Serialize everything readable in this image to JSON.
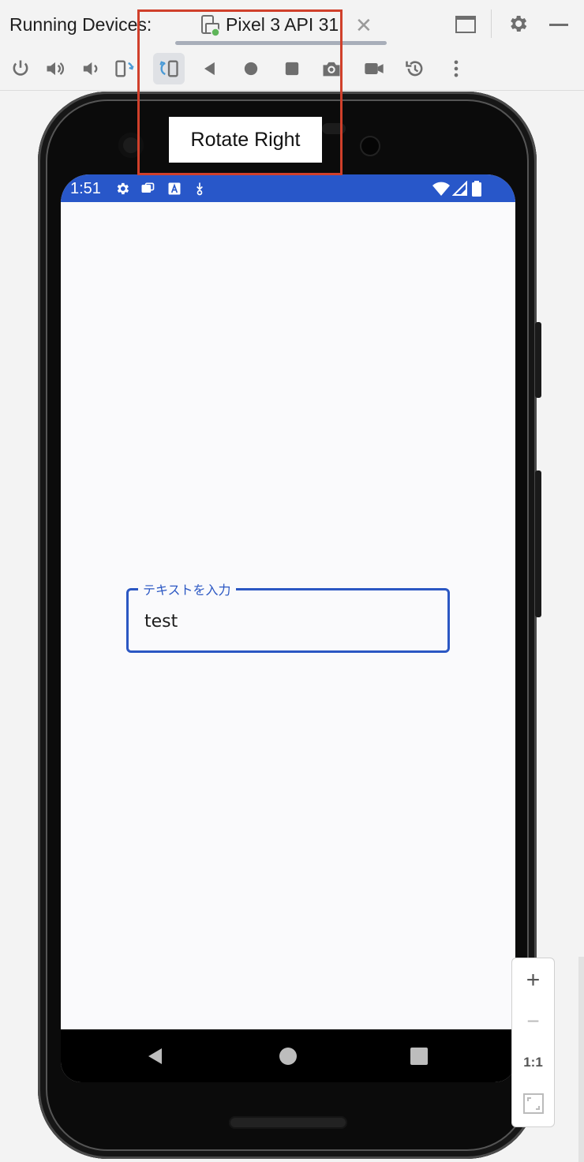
{
  "window": {
    "title_label": "Running Devices:",
    "tab": {
      "label": "Pixel 3 API 31",
      "icon": "device-phone-icon",
      "close_icon": "close-icon"
    },
    "actions": [
      "window-layout-icon",
      "gear-icon",
      "minimize-icon"
    ]
  },
  "toolbar": {
    "buttons": [
      "power-icon",
      "volume-up-icon",
      "volume-down-icon",
      "rotate-left-icon",
      "rotate-right-icon",
      "back-icon",
      "home-icon",
      "overview-icon",
      "screenshot-icon",
      "screen-record-icon",
      "snapshot-restore-icon",
      "more-icon"
    ],
    "active_button": "rotate-right-icon"
  },
  "tooltip": {
    "text": "Rotate Right"
  },
  "device": {
    "status_bar": {
      "time": "1:51",
      "icons": [
        "settings-icon",
        "notification-icon",
        "a-icon",
        "download-icon",
        "wifi-icon",
        "signal-icon",
        "battery-icon"
      ]
    },
    "textfield": {
      "label": "テキストを入力",
      "value": "test"
    },
    "navbar": [
      "back-nav-icon",
      "home-nav-icon",
      "recents-nav-icon"
    ]
  },
  "zoom": {
    "zoom_in": "+",
    "zoom_out": "−",
    "actual_size": "1:1",
    "fit": "fit-screen-icon"
  },
  "colors": {
    "accent": "#2b57c3",
    "statusbar": "#2857c9",
    "highlight": "#d0402b"
  }
}
